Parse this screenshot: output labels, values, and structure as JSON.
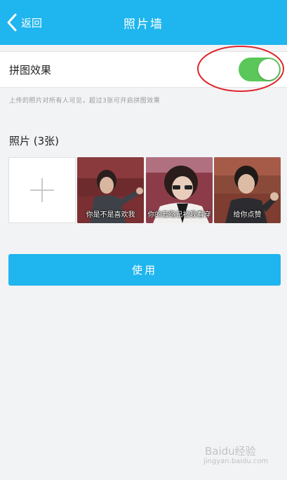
{
  "nav": {
    "back_label": "返回",
    "title": "照片墙"
  },
  "collage": {
    "label": "拼图效果",
    "enabled": true,
    "hint": "上传的照片对所有人可见，超过3张可开启拼图效果"
  },
  "photos_section": {
    "label": "照片 (3张)",
    "items": [
      {
        "caption": "你是不是喜欢我"
      },
      {
        "caption": "你的套路已被我看穿"
      },
      {
        "caption": "给你点赞"
      }
    ]
  },
  "use_button": {
    "label": "使用"
  },
  "watermark": {
    "text": "Baidu经验",
    "sub": "jingyan.baidu.com"
  },
  "colors": {
    "nav_bg": "#1fb5ee",
    "toggle_on": "#5bc75a",
    "annotation": "#e0242c"
  }
}
